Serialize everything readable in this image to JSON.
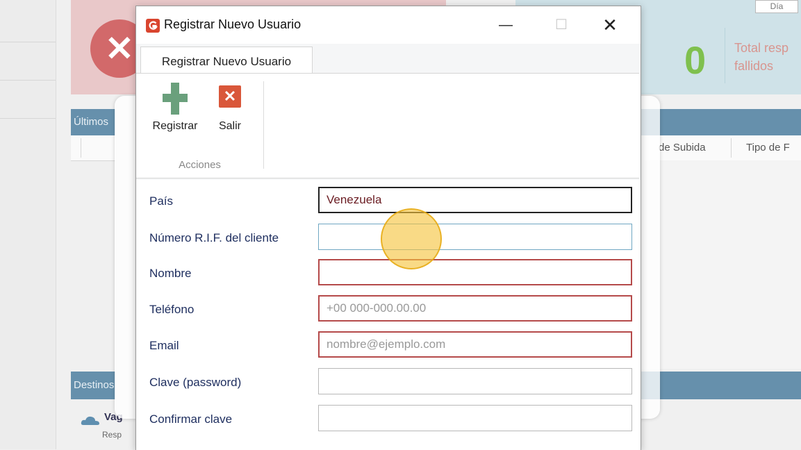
{
  "background": {
    "day_button": "Día",
    "ok_count": "0",
    "ok_text_line1": "Total resp",
    "ok_text_line2": "fallidos",
    "panel_recent_title": "Últimos",
    "col_upload_date": "de Subida",
    "col_type": "Tipo de F",
    "panel_dest_title": "Destinos",
    "dest_name": "Vag",
    "dest_sub": "Resp"
  },
  "dialog": {
    "title": "Registrar Nuevo Usuario",
    "tab_label": "Registrar Nuevo Usuario",
    "ribbon": {
      "register_label": "Registrar",
      "exit_label": "Salir",
      "group_label": "Acciones"
    },
    "form": {
      "country_label": "País",
      "country_value": "Venezuela",
      "rif_label": "Número R.I.F. del cliente",
      "rif_value": "",
      "name_label": "Nombre",
      "name_value": "",
      "phone_label": "Teléfono",
      "phone_placeholder": "+00 000-000.00.00",
      "email_label": "Email",
      "email_placeholder": "nombre@ejemplo.com",
      "password_label": "Clave (password)",
      "confirm_label": "Confirmar clave"
    }
  },
  "colors": {
    "error_border": "#b54a4a",
    "focus_border": "#6fa7c3",
    "accent_green": "#6aa07c",
    "exit_red": "#d9573a"
  }
}
